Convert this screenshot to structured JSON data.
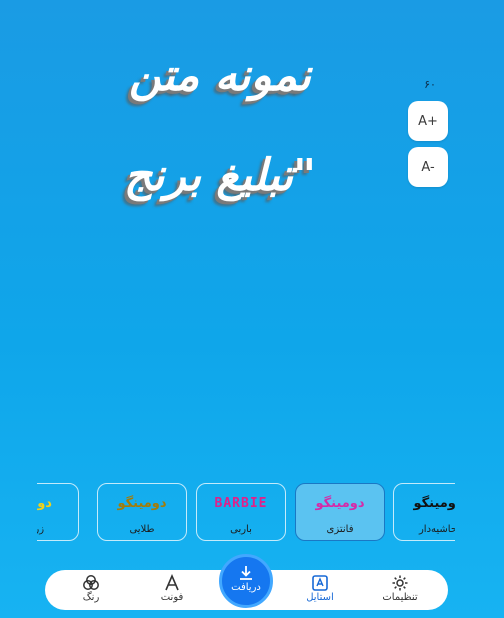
{
  "preview": {
    "line1": "نمونه متن",
    "line2": "\"تبلیغ برنج"
  },
  "font_size": {
    "value": "۶۰",
    "increase_label": "A+",
    "decrease_label": "A-"
  },
  "styles": [
    {
      "sample": "دومی",
      "name": "زرین",
      "sample_color": "#f1d21a"
    },
    {
      "sample": "دومینگو",
      "name": "طلایی",
      "sample_color": "#a37c09"
    },
    {
      "sample": "BARBIE",
      "name": "باربی",
      "sample_color": "#e0218a"
    },
    {
      "sample": "دومینگو",
      "name": "فانتزی",
      "sample_color": "#d62aa8",
      "selected": true
    },
    {
      "sample": "دومینگو",
      "name": "حاشیه‌دار",
      "sample_color": "#111111"
    }
  ],
  "bottom_nav": {
    "color": "رنگ",
    "font": "فونت",
    "download": "دریافت",
    "style": "استایل",
    "settings": "تنظیمات"
  },
  "colors": {
    "accent": "#1577f0",
    "active_nav": "#1769d6"
  }
}
